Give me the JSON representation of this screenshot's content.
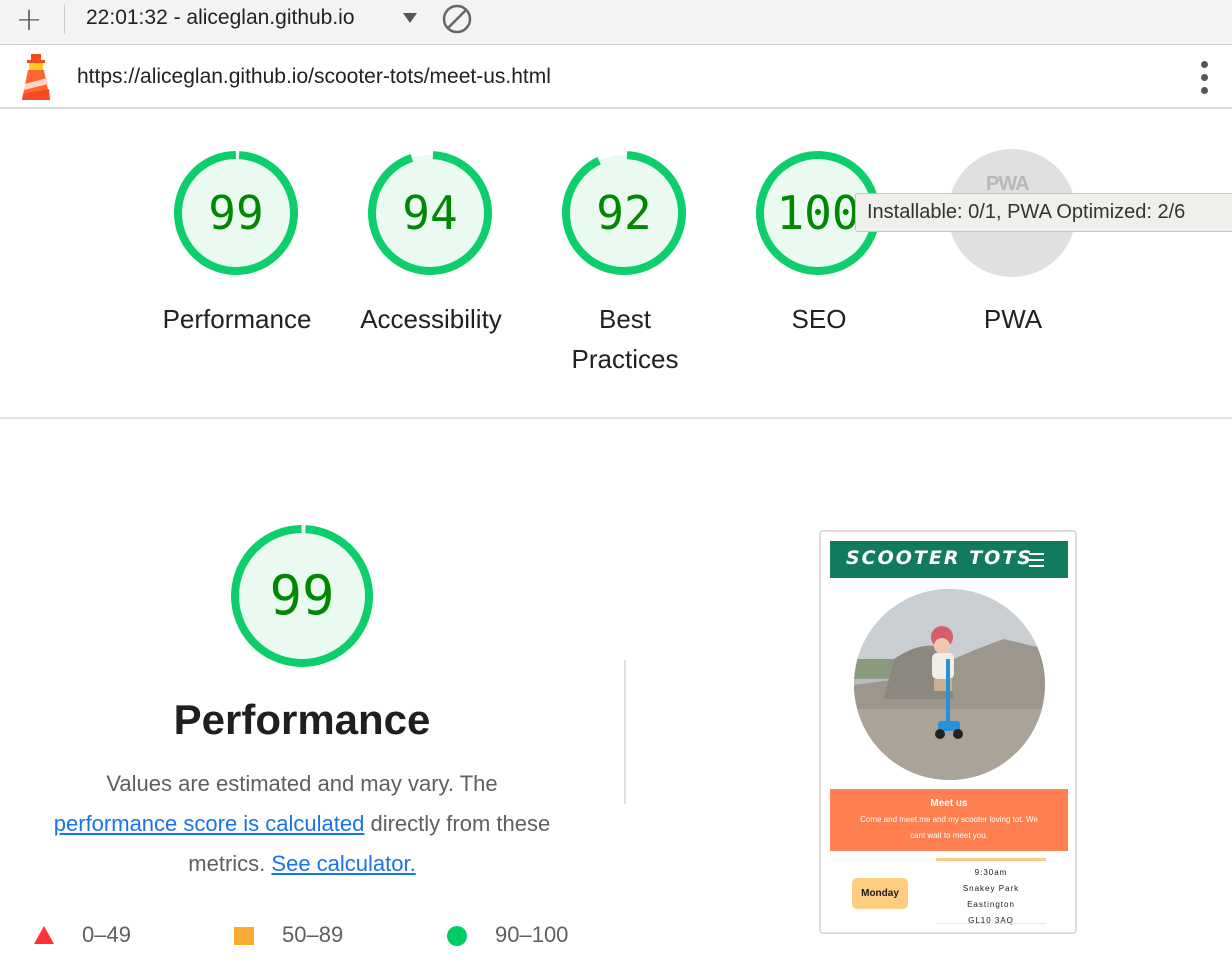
{
  "toolbar": {
    "report_title": "22:01:32 - aliceglan.github.io"
  },
  "urlbar": {
    "url": "https://aliceglan.github.io/scooter-tots/meet-us.html"
  },
  "categories": [
    {
      "label": "Performance",
      "score": "99",
      "fraction": 0.99
    },
    {
      "label": "Accessibility",
      "score": "94",
      "fraction": 0.94
    },
    {
      "label": "Best Practices",
      "score": "92",
      "fraction": 0.92
    },
    {
      "label": "SEO",
      "score": "100",
      "fraction": 1.0
    },
    {
      "label": "PWA",
      "badge": "PWA"
    }
  ],
  "tooltip": "Installable: 0/1, PWA Optimized: 2/6",
  "performance": {
    "score": "99",
    "fraction": 0.99,
    "title": "Performance",
    "desc_1": "Values are estimated and may vary. The",
    "link_score": "performance score is calculated",
    "desc_2": "directly from these metrics.",
    "link_calculator": "See calculator."
  },
  "legend": {
    "fail": "0–49",
    "average": "50–89",
    "pass": "90–100"
  },
  "screenshot": {
    "brand": "SCOOTER TOTS",
    "banner_title": "Meet us",
    "banner_text": "Come and meet me and my scooter loving tot. We cant wait to meet you.",
    "day": "Monday",
    "time": "9:30am",
    "place": "Snakey Park",
    "town": "Eastington",
    "postcode": "GL10 3AQ"
  },
  "colors": {
    "pass_green": "#0cce6b",
    "pass_text": "#008800",
    "pass_fill": "#eafaf1",
    "fail_red": "#ff3333",
    "average_orange": "#ffaa33",
    "link_blue": "#1a73e8",
    "brand_teal": "#127a5f",
    "banner_coral": "#ff7f50"
  },
  "icons": {
    "new_report": "plus-icon",
    "dropdown": "caret-down-icon",
    "clear": "block-icon",
    "logo": "lighthouse-icon",
    "menu": "more-vert-icon"
  }
}
